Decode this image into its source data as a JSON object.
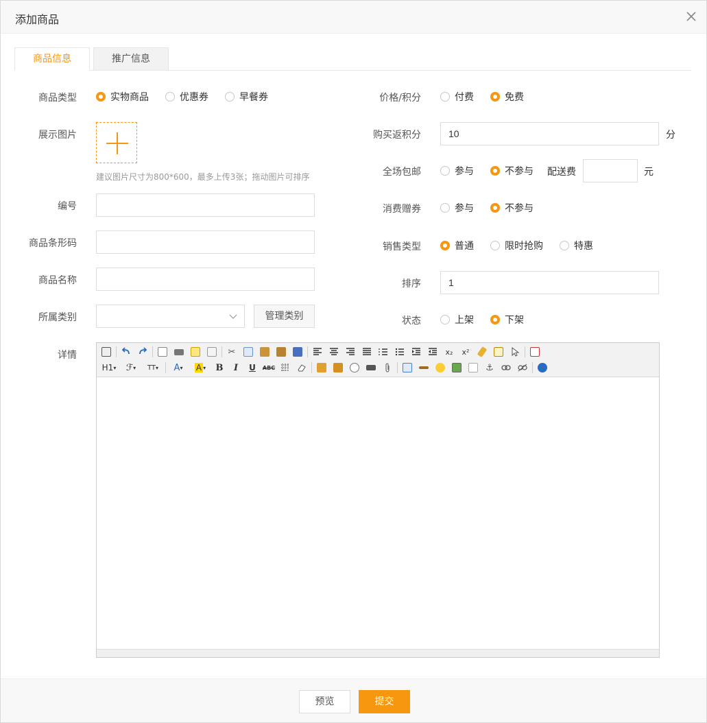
{
  "dialog": {
    "title": "添加商品",
    "close_icon": "close-icon"
  },
  "tabs": [
    {
      "label": "商品信息",
      "active": true
    },
    {
      "label": "推广信息",
      "active": false
    }
  ],
  "left": {
    "type": {
      "label": "商品类型",
      "options": [
        "实物商品",
        "优惠券",
        "早餐券"
      ],
      "selected": "实物商品"
    },
    "images": {
      "label": "展示图片",
      "hint": "建议图片尺寸为800*600，最多上传3张；拖动图片可排序"
    },
    "code": {
      "label": "编号",
      "value": ""
    },
    "barcode": {
      "label": "商品条形码",
      "value": ""
    },
    "name": {
      "label": "商品名称",
      "value": ""
    },
    "category": {
      "label": "所属类别",
      "value": "",
      "manage_label": "管理类别"
    },
    "detail": {
      "label": "详情"
    }
  },
  "right": {
    "price": {
      "label": "价格/积分",
      "options": [
        "付费",
        "免费"
      ],
      "selected": "免费"
    },
    "rebate": {
      "label": "购买返积分",
      "value": "10",
      "unit": "分"
    },
    "free_shipping": {
      "label": "全场包邮",
      "options": [
        "参与",
        "不参与"
      ],
      "selected": "不参与",
      "fee_label": "配送费",
      "fee_value": "",
      "fee_unit": "元"
    },
    "coupon_gift": {
      "label": "消费赠券",
      "options": [
        "参与",
        "不参与"
      ],
      "selected": "不参与"
    },
    "sale_type": {
      "label": "销售类型",
      "options": [
        "普通",
        "限时抢购",
        "特惠"
      ],
      "selected": "普通"
    },
    "sort": {
      "label": "排序",
      "value": "1"
    },
    "status": {
      "label": "状态",
      "options": [
        "上架",
        "下架"
      ],
      "selected": "下架"
    }
  },
  "editor_toolbar": {
    "heading_label": "H1",
    "font_label": "ℱ",
    "size_label": "TT",
    "font_color_label": "A",
    "bg_color_label": "A",
    "bold_label": "B",
    "italic_label": "I",
    "underline_label": "U",
    "strike_label": "ABC",
    "subscript_label": "x₂",
    "superscript_label": "x²"
  },
  "footer": {
    "preview_label": "预览",
    "submit_label": "提交"
  },
  "colors": {
    "accent": "#f7960f",
    "border": "#dcdcdc",
    "header_bg": "#f8f8f8"
  }
}
